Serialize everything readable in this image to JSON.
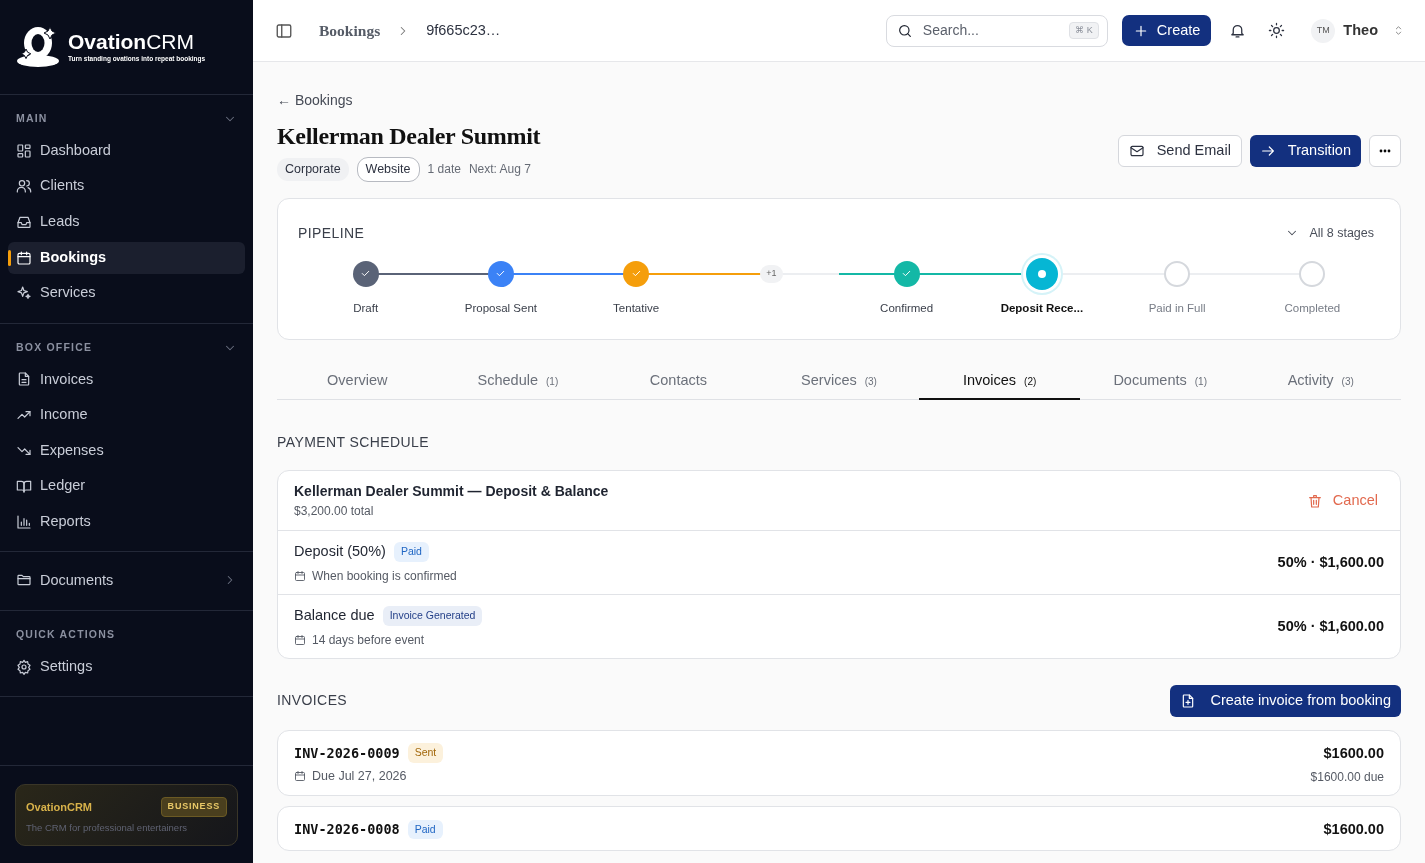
{
  "sidebar": {
    "brand": {
      "name": "**Ovation**CRM",
      "tagline": "Turn standing ovations into repeat bookings"
    },
    "sections": [
      {
        "title": "MAIN",
        "expanded": true,
        "items": [
          {
            "label": "Dashboard",
            "selected": false
          },
          {
            "label": "Clients",
            "selected": false
          },
          {
            "label": "Leads",
            "selected": false
          },
          {
            "label": "Bookings",
            "selected": true
          },
          {
            "label": "Services",
            "selected": false
          }
        ]
      },
      {
        "title": "BOX OFFICE",
        "expanded": true,
        "items": [
          {
            "label": "Invoices",
            "selected": false
          },
          {
            "label": "Income",
            "selected": false
          },
          {
            "label": "Expenses",
            "selected": false
          },
          {
            "label": "Ledger",
            "selected": false
          },
          {
            "label": "Reports",
            "selected": false
          }
        ]
      },
      {
        "items": [
          {
            "label": "Documents",
            "selected": false,
            "expanded": false
          }
        ]
      },
      {
        "title": "QUICK ACTIONS",
        "items": [
          {
            "label": "Settings",
            "selected": false
          }
        ]
      }
    ],
    "plan_card": {
      "name": "OvationCRM",
      "plan": "BUSINESS",
      "tagline": "The CRM for professional entertainers"
    }
  },
  "topbar": {
    "breadcrumb": [
      "Bookings",
      "9f665c23…"
    ],
    "search": {
      "placeholder": "Search...",
      "shortcut": "⌘ K"
    },
    "create_button": "Create",
    "user": {
      "initials": "TM",
      "name": "Theo"
    }
  },
  "header": {
    "back_link": "← Bookings",
    "title": "Kellerman Dealer Summit",
    "tags": [
      {
        "label": "Corporate",
        "kind": "filled"
      },
      {
        "label": "Website",
        "kind": "outline"
      }
    ],
    "meta": [
      "1 date",
      "Next: Aug 7"
    ],
    "buttons": [
      {
        "label": "Send Email",
        "kind": "outline"
      },
      {
        "label": "Transition",
        "kind": "primary"
      }
    ]
  },
  "pipeline": {
    "title": "PIPELINE",
    "toggle": "All 8 stages",
    "expanded": false,
    "stages": [
      {
        "kind": "stage",
        "label": "Draft",
        "completed": true,
        "current": false,
        "color": "#5a6377"
      },
      {
        "kind": "stage",
        "label": "Proposal Sent",
        "completed": true,
        "current": false,
        "color": "#3b82f6"
      },
      {
        "kind": "stage",
        "label": "Tentative",
        "completed": true,
        "current": false,
        "color": "#f59e0b"
      },
      {
        "kind": "more",
        "label": "+1"
      },
      {
        "kind": "stage",
        "label": "Confirmed",
        "completed": true,
        "current": false,
        "color": "#14b8a6"
      },
      {
        "kind": "stage",
        "label": "Deposit Rece...",
        "completed": false,
        "current": true,
        "color": "#06b6d4"
      },
      {
        "kind": "stage",
        "label": "Paid in Full",
        "completed": false,
        "current": false
      },
      {
        "kind": "stage",
        "label": "Completed",
        "completed": false,
        "current": false
      }
    ]
  },
  "tabs": [
    {
      "label": "Overview",
      "selected": false
    },
    {
      "label": "Schedule",
      "count": "(1)",
      "selected": false
    },
    {
      "label": "Contacts",
      "selected": false
    },
    {
      "label": "Services",
      "count": "(3)",
      "selected": false
    },
    {
      "label": "Invoices",
      "count": "(2)",
      "selected": true
    },
    {
      "label": "Documents",
      "count": "(1)",
      "selected": false
    },
    {
      "label": "Activity",
      "count": "(3)",
      "selected": false
    }
  ],
  "payment_schedule": {
    "title": "PAYMENT SCHEDULE",
    "plan": {
      "title": "Kellerman Dealer Summit — Deposit & Balance",
      "total": "$3,200.00 total",
      "action": "Cancel"
    },
    "rows": [
      {
        "name": "Deposit (50%)",
        "badge": {
          "label": "Paid",
          "kind": "paid"
        },
        "when": "When booking is confirmed",
        "amount": "50% · $1,600.00"
      },
      {
        "name": "Balance due",
        "badge": {
          "label": "Invoice Generated",
          "kind": "generated"
        },
        "when": "14 days before event",
        "amount": "50% · $1,600.00"
      }
    ]
  },
  "invoices": {
    "title": "INVOICES",
    "button": "Create invoice from booking",
    "items": [
      {
        "number": "INV-2026-0009",
        "status": {
          "label": "Sent",
          "kind": "sent"
        },
        "due": "Due Jul 27, 2026",
        "amount": "$1600.00",
        "note": "$1600.00 due"
      },
      {
        "number": "INV-2026-0008",
        "status": {
          "label": "Paid",
          "kind": "paid"
        },
        "amount": "$1600.00"
      }
    ]
  }
}
